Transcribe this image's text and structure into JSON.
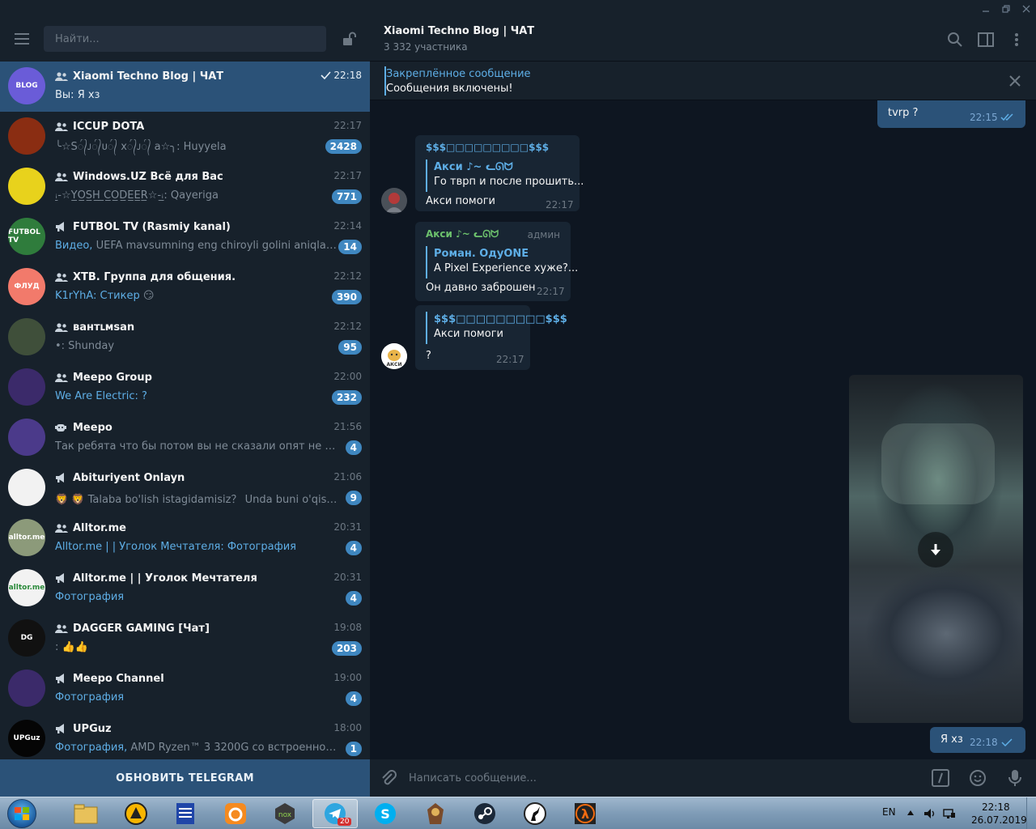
{
  "window": {
    "controls": [
      "minimize-icon",
      "restore-icon",
      "close-icon"
    ]
  },
  "sidebar": {
    "search_placeholder": "Найти...",
    "update_button": "ОБНОВИТЬ TELEGRAM",
    "chats": [
      {
        "name": "Xiaomi Techno Blog | ЧАТ",
        "type": "group",
        "time": "22:18",
        "sender": "",
        "preview": "Вы: Я хз",
        "unread": "",
        "active": true,
        "read_check": true,
        "avatar_text": "BLOG",
        "avatar_color": "#6a5cd8"
      },
      {
        "name": "ICCUP DOTA",
        "type": "group",
        "time": "22:17",
        "sender": "",
        "preview": "╰☆S᭄ᴊ᭄ᴜ᭄ x᭄ᴊ᭄ a☆╮: Huyyela",
        "unread": "2428",
        "active": false,
        "avatar_text": "",
        "avatar_color": "#8a2d12"
      },
      {
        "name": "Windows.UZ Всё для Вас",
        "type": "group",
        "time": "22:17",
        "sender": "",
        "preview": "ꜟ̲-☆Y̲O̲S̲H̲ ̲C̲O̲D̲E̲E̲R̲☆-ꜟ̲: Qayeriga",
        "unread": "771",
        "active": false,
        "avatar_text": "",
        "avatar_color": "#e8d21c"
      },
      {
        "name": "FUTBOL TV (Rasmiy kanal)",
        "type": "channel",
        "time": "22:14",
        "sender": "Видео,",
        "preview": " UEFA mavsumning eng chiroyli golini aniqlash uch...",
        "unread": "14",
        "active": false,
        "avatar_text": "FUTBOL TV",
        "avatar_color": "#2f7c3c"
      },
      {
        "name": "XTB. Группа для общения.",
        "type": "group",
        "time": "22:12",
        "sender": "K1rYhA: Стикер",
        "preview": " 😏",
        "unread": "390",
        "active": false,
        "avatar_text": "ФЛУД",
        "avatar_color": "#f27a6b"
      },
      {
        "name": "вантւмsan",
        "type": "group",
        "time": "22:12",
        "sender": "",
        "preview": "•: Shunday",
        "unread": "95",
        "active": false,
        "avatar_text": "",
        "avatar_color": "#3f4f3a"
      },
      {
        "name": "Meepo Group",
        "type": "group",
        "time": "22:00",
        "sender": "We Are Electric: ?",
        "preview": "",
        "unread": "232",
        "active": false,
        "avatar_text": "",
        "avatar_color": "#3b2a6a"
      },
      {
        "name": "Meepo",
        "type": "bot",
        "time": "21:56",
        "sender": "",
        "preview": "Так ребята что бы потом вы не сказали опят не понятн...",
        "unread": "4",
        "active": false,
        "avatar_text": "",
        "avatar_color": "#4b3a8a"
      },
      {
        "name": "Abituriyent Onlayn",
        "type": "channel",
        "time": "21:06",
        "sender": "",
        "preview": "🦁 🦁 Talaba bo'lish istagidamisiz？ Unda buni o'qishingiz ...",
        "unread": "9",
        "active": false,
        "avatar_text": "",
        "avatar_color": "#f2f2f2"
      },
      {
        "name": "Alltor.me",
        "type": "group",
        "time": "20:31",
        "sender": "Alltor.me | | Уголок Мечтателя: Фотография",
        "preview": "",
        "unread": "4",
        "active": false,
        "avatar_text": "alltor.me",
        "avatar_color": "#8c9a7a"
      },
      {
        "name": "Alltor.me | | Уголок Мечтателя",
        "type": "channel",
        "time": "20:31",
        "sender": "Фотография",
        "preview": "",
        "unread": "4",
        "active": false,
        "avatar_text": "alltor.me",
        "avatar_color": "#f2f2f2"
      },
      {
        "name": "DAGGER GAMING [Чат]",
        "type": "group",
        "time": "19:08",
        "sender": "",
        "preview": ": 👍👍",
        "unread": "203",
        "active": false,
        "avatar_text": "DG",
        "avatar_color": "#111111"
      },
      {
        "name": "Meepo Channel",
        "type": "channel",
        "time": "19:00",
        "sender": "Фотография",
        "preview": "",
        "unread": "4",
        "active": false,
        "avatar_text": "",
        "avatar_color": "#3b2a6a"
      },
      {
        "name": "UPGuz",
        "type": "channel",
        "time": "18:00",
        "sender": "Фотография,",
        "preview": " AMD Ryzen™ 3 3200G со встроенной мощн...",
        "unread": "1",
        "active": false,
        "avatar_text": "UPGuz",
        "avatar_color": "#050505"
      }
    ]
  },
  "main": {
    "title": "Xiaomi Techno Blog | ЧАТ",
    "subtitle": "3 332 участника",
    "pinned": {
      "title": "Закреплённое сообщение",
      "text": "Сообщения включены!"
    },
    "messages": {
      "m0": {
        "text": "tvrp ?",
        "time": "22:15"
      },
      "m1": {
        "author": "$$$□□□□□□□□□$$$",
        "reply_author": "Акси ♪~ ᓚᘏᗢ",
        "reply_text": "Го тврп и после прошить...",
        "text": "Акси помоги",
        "time": "22:17"
      },
      "m2": {
        "author": "Акси ♪~ ᓚᘏᗢ",
        "admin": "админ",
        "reply_author": "Роман. ОдуONE",
        "reply_text": "А Pixel Experience хуже?...",
        "text": "Он давно заброшен",
        "time": "22:17"
      },
      "m3": {
        "reply_author": "$$$□□□□□□□□□$$$",
        "reply_text": "Акси помоги",
        "text": "?",
        "time": "22:17"
      },
      "m4": {
        "text": "Я хз",
        "time": "22:18"
      }
    },
    "composer_placeholder": "Написать сообщение..."
  },
  "taskbar": {
    "lang": "EN",
    "time": "22:18",
    "date": "26.07.2019",
    "telegram_badge": "20"
  },
  "colors": {
    "accent": "#5eaee6",
    "active_chat": "#2b5278",
    "sidebar_bg": "#17212b",
    "chat_bg": "#0e1621",
    "badge": "#3f87c0"
  }
}
